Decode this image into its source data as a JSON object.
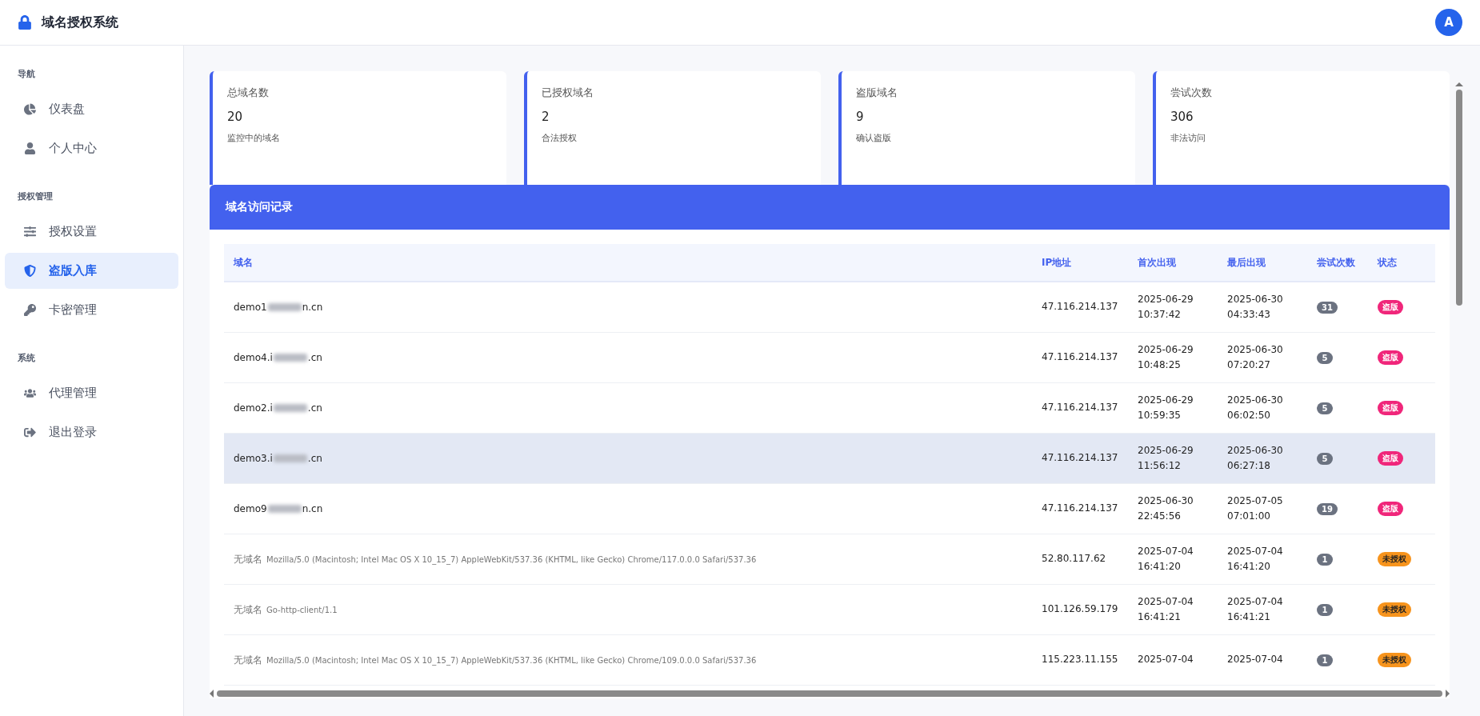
{
  "header": {
    "title": "域名授权系统",
    "avatar": "A"
  },
  "sidebar": {
    "sections": [
      {
        "title": "导航",
        "items": [
          {
            "label": "仪表盘",
            "selected": false
          },
          {
            "label": "个人中心",
            "selected": false
          }
        ]
      },
      {
        "title": "授权管理",
        "items": [
          {
            "label": "授权设置",
            "selected": false
          },
          {
            "label": "盗版入库",
            "selected": true
          },
          {
            "label": "卡密管理",
            "selected": false
          }
        ]
      },
      {
        "title": "系统",
        "items": [
          {
            "label": "代理管理",
            "selected": false
          },
          {
            "label": "退出登录",
            "selected": false
          }
        ]
      }
    ]
  },
  "stats": [
    {
      "title": "总域名数",
      "value": "20",
      "caption": "监控中的域名"
    },
    {
      "title": "已授权域名",
      "value": "2",
      "caption": "合法授权"
    },
    {
      "title": "盗版域名",
      "value": "9",
      "caption": "确认盗版"
    },
    {
      "title": "尝试次数",
      "value": "306",
      "caption": "非法访问"
    }
  ],
  "records": {
    "title": "域名访问记录",
    "columns": [
      "域名",
      "IP地址",
      "首次出现",
      "最后出现",
      "尝试次数",
      "状态"
    ],
    "rows": [
      {
        "kind": "domain",
        "domain_start": "demo1",
        "domain_end": "n.cn",
        "ip": "47.116.214.137",
        "first": [
          "2025-06-29",
          "10:37:42"
        ],
        "last": [
          "2025-06-30",
          "04:33:43"
        ],
        "count": "31",
        "status": {
          "kind": "pirated",
          "label": "盗版"
        },
        "highlighted": false
      },
      {
        "kind": "domain",
        "domain_start": "demo4.i",
        "domain_end": ".cn",
        "ip": "47.116.214.137",
        "first": [
          "2025-06-29",
          "10:48:25"
        ],
        "last": [
          "2025-06-30",
          "07:20:27"
        ],
        "count": "5",
        "status": {
          "kind": "pirated",
          "label": "盗版"
        },
        "highlighted": false
      },
      {
        "kind": "domain",
        "domain_start": "demo2.i",
        "domain_end": ".cn",
        "ip": "47.116.214.137",
        "first": [
          "2025-06-29",
          "10:59:35"
        ],
        "last": [
          "2025-06-30",
          "06:02:50"
        ],
        "count": "5",
        "status": {
          "kind": "pirated",
          "label": "盗版"
        },
        "highlighted": false
      },
      {
        "kind": "domain",
        "domain_start": "demo3.i",
        "domain_end": ".cn",
        "ip": "47.116.214.137",
        "first": [
          "2025-06-29",
          "11:56:12"
        ],
        "last": [
          "2025-06-30",
          "06:27:18"
        ],
        "count": "5",
        "status": {
          "kind": "pirated",
          "label": "盗版"
        },
        "highlighted": true
      },
      {
        "kind": "domain",
        "domain_start": "demo9",
        "domain_end": "n.cn",
        "ip": "47.116.214.137",
        "first": [
          "2025-06-30",
          "22:45:56"
        ],
        "last": [
          "2025-07-05",
          "07:01:00"
        ],
        "count": "19",
        "status": {
          "kind": "pirated",
          "label": "盗版"
        },
        "highlighted": false
      },
      {
        "kind": "no_domain",
        "label": "无域名",
        "agent": "Mozilla/5.0 (Macintosh; Intel Mac OS X 10_15_7) AppleWebKit/537.36 (KHTML, like Gecko) Chrome/117.0.0.0 Safari/537.36",
        "ip": "52.80.117.62",
        "first": [
          "2025-07-04",
          "16:41:20"
        ],
        "last": [
          "2025-07-04",
          "16:41:20"
        ],
        "count": "1",
        "status": {
          "kind": "unauthorized",
          "label": "未授权"
        },
        "highlighted": false
      },
      {
        "kind": "no_domain",
        "label": "无域名",
        "agent": "Go-http-client/1.1",
        "ip": "101.126.59.179",
        "first": [
          "2025-07-04",
          "16:41:21"
        ],
        "last": [
          "2025-07-04",
          "16:41:21"
        ],
        "count": "1",
        "status": {
          "kind": "unauthorized",
          "label": "未授权"
        },
        "highlighted": false
      },
      {
        "kind": "no_domain",
        "label": "无域名",
        "agent": "Mozilla/5.0 (Macintosh; Intel Mac OS X 10_15_7) AppleWebKit/537.36 (KHTML, like Gecko) Chrome/109.0.0.0 Safari/537.36",
        "ip": "115.223.11.155",
        "first": [
          "2025-07-04"
        ],
        "last": [
          "2025-07-04"
        ],
        "count": "1",
        "status": {
          "kind": "unauthorized",
          "label": "未授权"
        },
        "highlighted": false
      }
    ]
  }
}
